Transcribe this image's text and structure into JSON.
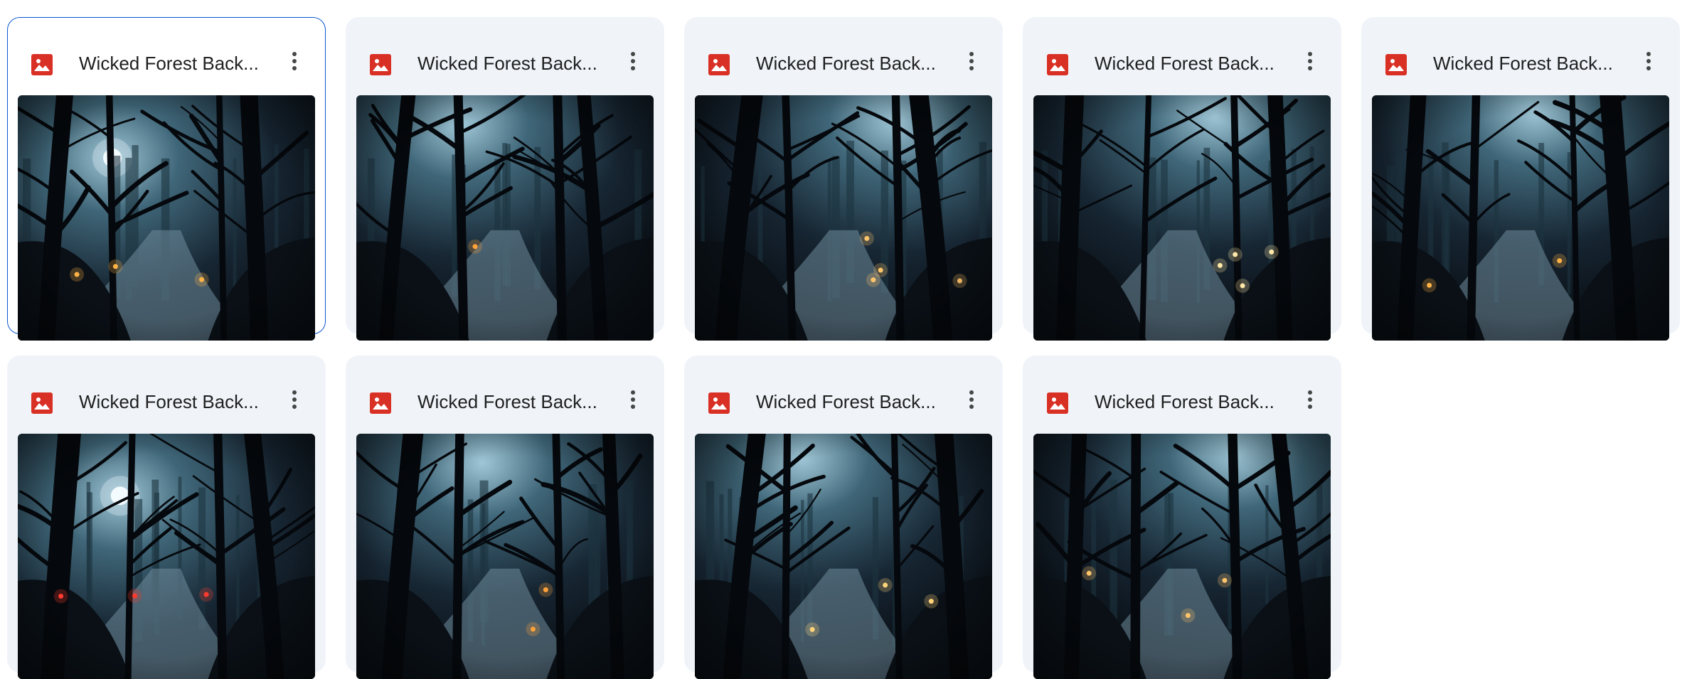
{
  "files": [
    {
      "name": "Wicked Forest Back...",
      "selected": true,
      "thumbnail": {
        "scene": "moonlit-forest-path",
        "moon": true,
        "lanterns": 3,
        "lantern_color": "#ffb347"
      }
    },
    {
      "name": "Wicked Forest Back...",
      "selected": false,
      "thumbnail": {
        "scene": "forest-stream",
        "moon": false,
        "lanterns": 1,
        "lantern_color": "#ffa23a"
      }
    },
    {
      "name": "Wicked Forest Back...",
      "selected": false,
      "thumbnail": {
        "scene": "lantern-path",
        "moon": false,
        "lanterns": 4,
        "lantern_color": "#ffc56b"
      }
    },
    {
      "name": "Wicked Forest Back...",
      "selected": false,
      "thumbnail": {
        "scene": "lantern-path",
        "moon": false,
        "lanterns": 4,
        "lantern_color": "#ffe9a8"
      }
    },
    {
      "name": "Wicked Forest Back...",
      "selected": false,
      "thumbnail": {
        "scene": "forest-path",
        "moon": false,
        "lanterns": 2,
        "lantern_color": "#ffb347"
      }
    },
    {
      "name": "Wicked Forest Back...",
      "selected": false,
      "thumbnail": {
        "scene": "full-moon-path",
        "moon": true,
        "lanterns": 3,
        "lantern_color": "#ff3b2f"
      }
    },
    {
      "name": "Wicked Forest Back...",
      "selected": false,
      "thumbnail": {
        "scene": "graveyard-path",
        "moon": false,
        "lanterns": 2,
        "lantern_color": "#ffa23a"
      }
    },
    {
      "name": "Wicked Forest Back...",
      "selected": false,
      "thumbnail": {
        "scene": "glowing-path",
        "moon": false,
        "lanterns": 3,
        "lantern_color": "#ffd37a"
      }
    },
    {
      "name": "Wicked Forest Back...",
      "selected": false,
      "thumbnail": {
        "scene": "candle-forest",
        "moon": false,
        "lanterns": 3,
        "lantern_color": "#ffc56b"
      }
    }
  ],
  "icons": {
    "file_type": "image-file-icon",
    "more": "more-vert-icon"
  },
  "colors": {
    "accent": "#0b57d0",
    "file_icon": "#d93025",
    "card_bg": "#f0f4f9"
  }
}
